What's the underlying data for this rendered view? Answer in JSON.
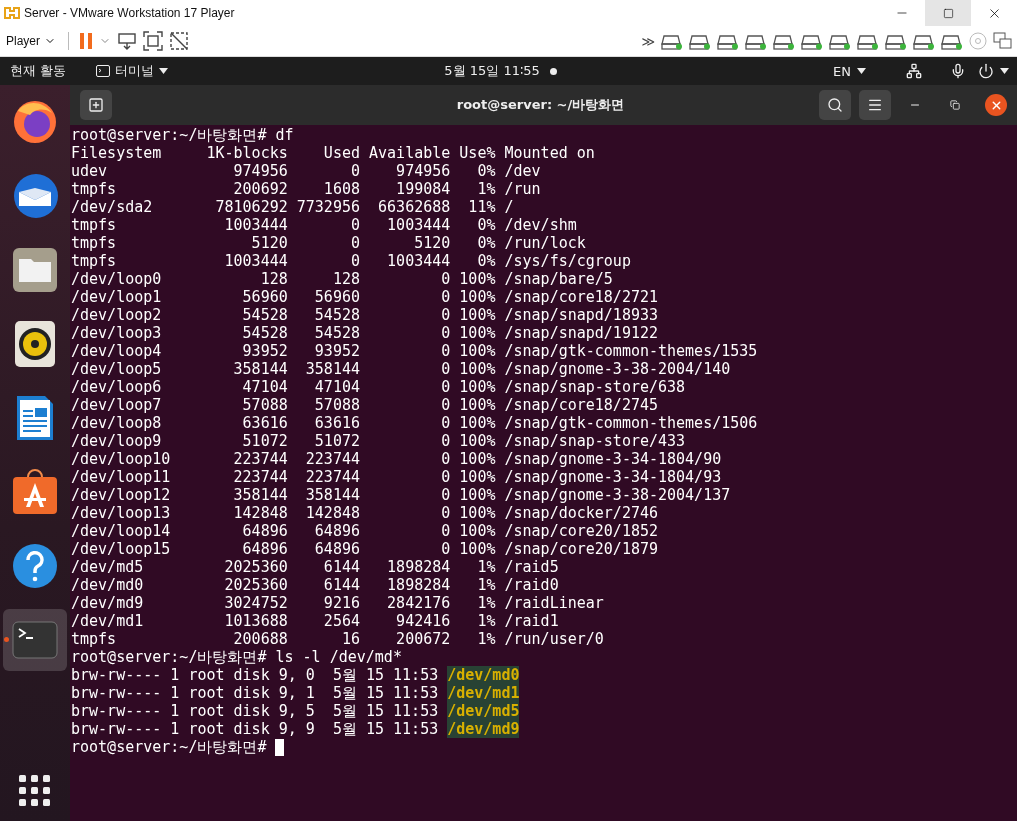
{
  "vmware": {
    "title": "Server - VMware Workstation 17 Player",
    "player_menu": "Player",
    "more": "≫"
  },
  "topbar": {
    "activities": "현재 활동",
    "app": "터미널",
    "clock": "5월 15일 11∶55",
    "notification": true,
    "language": "EN"
  },
  "dock": [
    {
      "kind": "firefox",
      "selected": false
    },
    {
      "kind": "mail",
      "selected": false
    },
    {
      "kind": "files",
      "selected": false
    },
    {
      "kind": "music",
      "selected": false
    },
    {
      "kind": "writer",
      "selected": false
    },
    {
      "kind": "store",
      "selected": false
    },
    {
      "kind": "help",
      "selected": false
    },
    {
      "kind": "terminal",
      "selected": true
    }
  ],
  "terminal": {
    "title": "root@server: ~/바탕화면",
    "blocks": [
      {
        "kind": "command",
        "prompt": "root@server:~/바탕화면#",
        "command": "df"
      },
      {
        "kind": "table",
        "columns": [
          "Filesystem",
          "1K-blocks",
          "Used",
          "Available",
          "Use%",
          "Mounted on"
        ],
        "rows": [
          [
            "udev",
            "974956",
            "0",
            "974956",
            "0%",
            "/dev"
          ],
          [
            "tmpfs",
            "200692",
            "1608",
            "199084",
            "1%",
            "/run"
          ],
          [
            "/dev/sda2",
            "78106292",
            "7732956",
            "66362688",
            "11%",
            "/"
          ],
          [
            "tmpfs",
            "1003444",
            "0",
            "1003444",
            "0%",
            "/dev/shm"
          ],
          [
            "tmpfs",
            "5120",
            "0",
            "5120",
            "0%",
            "/run/lock"
          ],
          [
            "tmpfs",
            "1003444",
            "0",
            "1003444",
            "0%",
            "/sys/fs/cgroup"
          ],
          [
            "/dev/loop0",
            "128",
            "128",
            "0",
            "100%",
            "/snap/bare/5"
          ],
          [
            "/dev/loop1",
            "56960",
            "56960",
            "0",
            "100%",
            "/snap/core18/2721"
          ],
          [
            "/dev/loop2",
            "54528",
            "54528",
            "0",
            "100%",
            "/snap/snapd/18933"
          ],
          [
            "/dev/loop3",
            "54528",
            "54528",
            "0",
            "100%",
            "/snap/snapd/19122"
          ],
          [
            "/dev/loop4",
            "93952",
            "93952",
            "0",
            "100%",
            "/snap/gtk-common-themes/1535"
          ],
          [
            "/dev/loop5",
            "358144",
            "358144",
            "0",
            "100%",
            "/snap/gnome-3-38-2004/140"
          ],
          [
            "/dev/loop6",
            "47104",
            "47104",
            "0",
            "100%",
            "/snap/snap-store/638"
          ],
          [
            "/dev/loop7",
            "57088",
            "57088",
            "0",
            "100%",
            "/snap/core18/2745"
          ],
          [
            "/dev/loop8",
            "63616",
            "63616",
            "0",
            "100%",
            "/snap/gtk-common-themes/1506"
          ],
          [
            "/dev/loop9",
            "51072",
            "51072",
            "0",
            "100%",
            "/snap/snap-store/433"
          ],
          [
            "/dev/loop10",
            "223744",
            "223744",
            "0",
            "100%",
            "/snap/gnome-3-34-1804/90"
          ],
          [
            "/dev/loop11",
            "223744",
            "223744",
            "0",
            "100%",
            "/snap/gnome-3-34-1804/93"
          ],
          [
            "/dev/loop12",
            "358144",
            "358144",
            "0",
            "100%",
            "/snap/gnome-3-38-2004/137"
          ],
          [
            "/dev/loop13",
            "142848",
            "142848",
            "0",
            "100%",
            "/snap/docker/2746"
          ],
          [
            "/dev/loop14",
            "64896",
            "64896",
            "0",
            "100%",
            "/snap/core20/1852"
          ],
          [
            "/dev/loop15",
            "64896",
            "64896",
            "0",
            "100%",
            "/snap/core20/1879"
          ],
          [
            "/dev/md5",
            "2025360",
            "6144",
            "1898284",
            "1%",
            "/raid5"
          ],
          [
            "/dev/md0",
            "2025360",
            "6144",
            "1898284",
            "1%",
            "/raid0"
          ],
          [
            "/dev/md9",
            "3024752",
            "9216",
            "2842176",
            "1%",
            "/raidLinear"
          ],
          [
            "/dev/md1",
            "1013688",
            "2564",
            "942416",
            "1%",
            "/raid1"
          ],
          [
            "tmpfs",
            "200688",
            "16",
            "200672",
            "1%",
            "/run/user/0"
          ]
        ]
      },
      {
        "kind": "command",
        "prompt": "root@server:~/바탕화면#",
        "command": "ls -l /dev/md*"
      },
      {
        "kind": "listing",
        "rows": [
          {
            "entry": "brw-rw---- 1 root disk 9, 0  5월 15 11:53",
            "path": "/dev/md0"
          },
          {
            "entry": "brw-rw---- 1 root disk 9, 1  5월 15 11:53",
            "path": "/dev/md1"
          },
          {
            "entry": "brw-rw---- 1 root disk 9, 5  5월 15 11:53",
            "path": "/dev/md5"
          },
          {
            "entry": "brw-rw---- 1 root disk 9, 9  5월 15 11:53",
            "path": "/dev/md9"
          }
        ]
      },
      {
        "kind": "command",
        "prompt": "root@server:~/바탕화면#",
        "cursor": true
      }
    ]
  }
}
